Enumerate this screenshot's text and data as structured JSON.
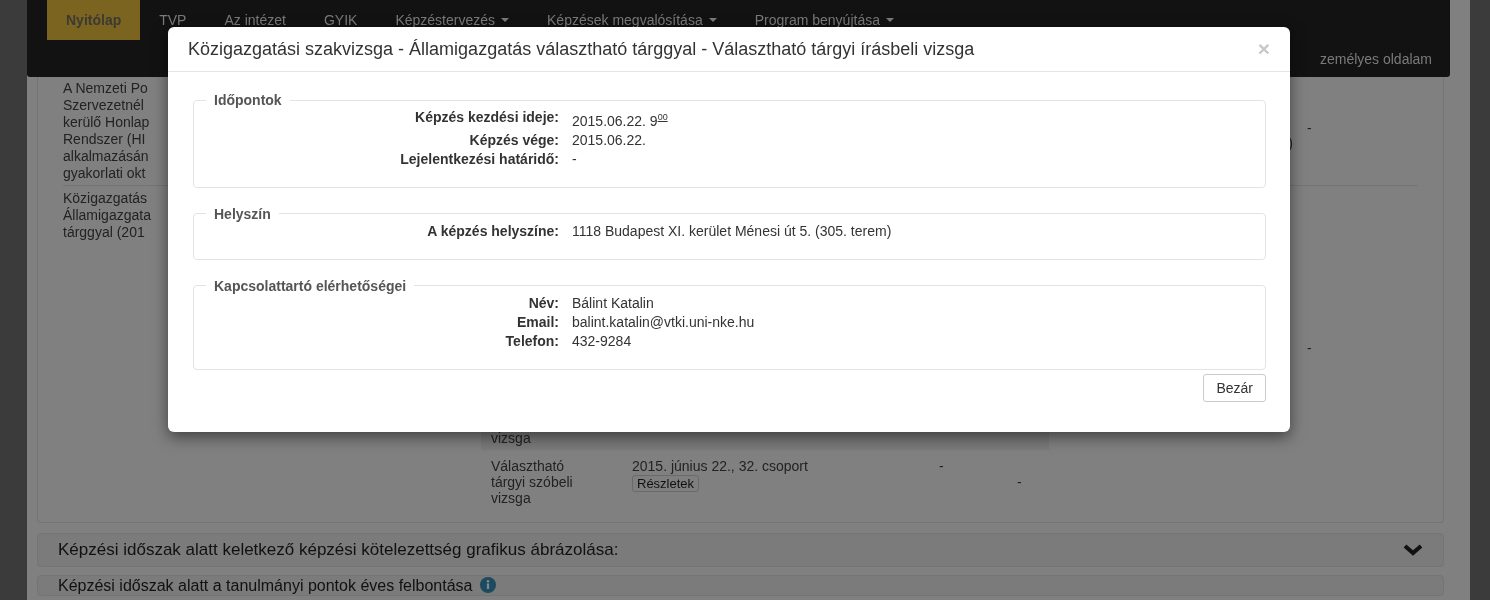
{
  "navbar": {
    "items": [
      {
        "label": "Nyitólap",
        "selected": true,
        "dropdown": false
      },
      {
        "label": "TVP",
        "selected": false,
        "dropdown": false
      },
      {
        "label": "Az intézet",
        "selected": false,
        "dropdown": false
      },
      {
        "label": "GYIK",
        "selected": false,
        "dropdown": false
      },
      {
        "label": "Képzéstervezés",
        "selected": false,
        "dropdown": true
      },
      {
        "label": "Képzések megvalósítása",
        "selected": false,
        "dropdown": true
      },
      {
        "label": "Program benyújtása",
        "selected": false,
        "dropdown": true
      }
    ],
    "user_link": "zemélyes oldalam"
  },
  "course_rows": [
    {
      "title_lines": [
        "A Nemzeti Po",
        "Szervezetnél",
        "kerülő Honlap",
        "Rendszer (HI",
        "alkalmazásán",
        "gyakorlati okt"
      ],
      "detail_end": ")",
      "column_4": "-",
      "sessions": []
    },
    {
      "title_lines": [
        "Közigazgatás",
        "Államigazgata",
        "tárggyal (201"
      ],
      "detail_end": "",
      "column_4": "-",
      "sessions": [
        {
          "name_lines": [
            "vizsga"
          ],
          "highlighted": true
        },
        {
          "name_lines": [
            "Választható",
            "tárgyi szóbeli",
            "vizsga"
          ],
          "date": "2015. június 22., 32. csoport",
          "details_button": "Részletek",
          "column_3": "-",
          "column_4": "-",
          "highlighted": false
        }
      ]
    }
  ],
  "panels": [
    {
      "title": "Képzési időszak alatt keletkező képzési kötelezettség grafikus ábrázolása:",
      "kind": "chevron"
    },
    {
      "title": "Képzési időszak alatt a tanulmányi pontok éves felbontása",
      "kind": "info"
    }
  ],
  "modal": {
    "title": "Közigazgatási szakvizsga - Államigazgatás választható tárggyal - Választható tárgyi írásbeli vizsga",
    "close": "×",
    "sections": [
      {
        "legend": "Időpontok",
        "fields": [
          {
            "label": "Képzés kezdési ideje:",
            "value": "2015.06.22. 9$^{00}$"
          },
          {
            "label": "Képzés vége:",
            "value": "2015.06.22."
          },
          {
            "label": "Lejelentkezési határidő:",
            "value": "-"
          }
        ]
      },
      {
        "legend": "Helyszín",
        "fields": [
          {
            "label": "A képzés helyszíne:",
            "value": "1118 Budapest XI. kerület Ménesi út 5. (305. terem)"
          }
        ]
      },
      {
        "legend": "Kapcsolattartó elérhetőségei",
        "fields": [
          {
            "label": "Név:",
            "value": "Bálint Katalin"
          },
          {
            "label": "Email:",
            "value": "balint.katalin@vtki.uni-nke.hu"
          },
          {
            "label": "Telefon:",
            "value": "432-9284"
          }
        ]
      }
    ],
    "close_button": "Bezár"
  }
}
